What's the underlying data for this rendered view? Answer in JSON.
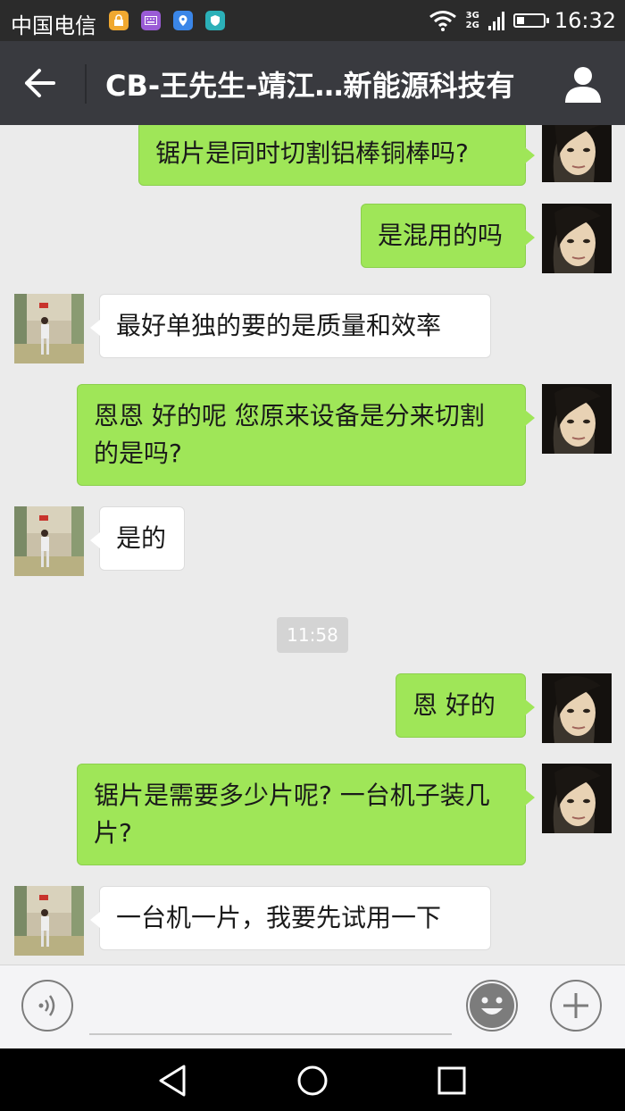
{
  "status_bar": {
    "carrier": "中国电信",
    "network_top": "3G",
    "network_bottom": "2G",
    "battery_level": 0.3,
    "time": "16:32",
    "notification_icons": [
      "lock-app-icon",
      "keyboard-app-icon",
      "location-app-icon",
      "shield-app-icon"
    ]
  },
  "header": {
    "title": "CB-王先生-靖江…新能源科技有"
  },
  "messages": [
    {
      "side": "out",
      "text": "锯片是同时切割铝棒铜棒吗?"
    },
    {
      "side": "out",
      "text": "是混用的吗"
    },
    {
      "side": "in",
      "text": "最好单独的要的是质量和效率"
    },
    {
      "side": "out",
      "text": "恩恩 好的呢   您原来设备是分来切割的是吗?"
    },
    {
      "side": "in",
      "text": "是的"
    },
    {
      "type": "time",
      "text": "11:58"
    },
    {
      "side": "out",
      "text": "恩 好的"
    },
    {
      "side": "out",
      "text": "锯片是需要多少片呢?   一台机子装几片?"
    },
    {
      "side": "in",
      "text": "一台机一片，我要先试用一下"
    }
  ],
  "colors": {
    "outgoing_bubble": "#9fe658",
    "incoming_bubble": "#ffffff",
    "title_bar": "#393a3f",
    "chat_background": "#ebebeb"
  }
}
